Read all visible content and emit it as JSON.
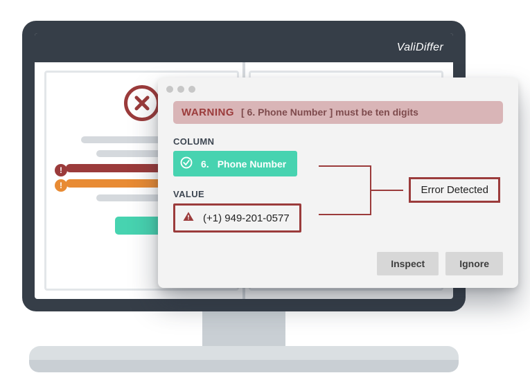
{
  "brand": "ValiDiffer",
  "leftPanel": {
    "statusIcon": "x",
    "errorBullet": "!",
    "warnBullet": "!"
  },
  "popup": {
    "warning": {
      "label": "WARNING",
      "text": "[ 6.   Phone Number ] must be ten digits"
    },
    "columnLabel": "COLUMN",
    "column": {
      "index": "6.",
      "name": "Phone Number"
    },
    "valueLabel": "VALUE",
    "value": "(+1) 949-201-0577",
    "errorDetected": "Error Detected",
    "actions": {
      "inspect": "Inspect",
      "ignore": "Ignore"
    }
  },
  "colors": {
    "accent": "#47d3b0",
    "error": "#9b3b3b",
    "warn": "#e88b34",
    "headerBg": "#363e48"
  }
}
